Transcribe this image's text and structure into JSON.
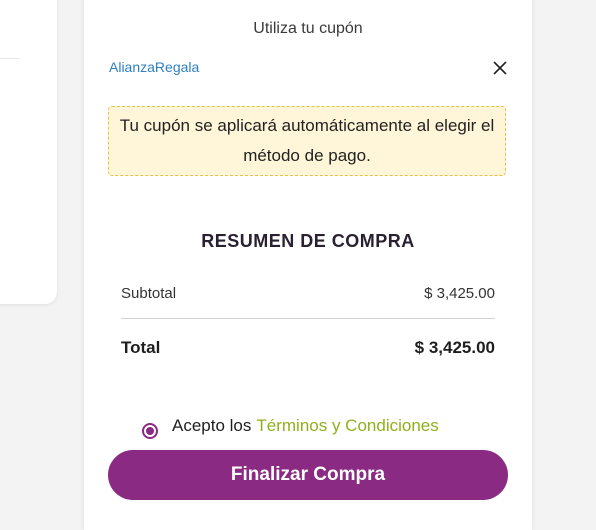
{
  "coupon": {
    "title": "Utiliza tu cupón",
    "code": "AlianzaRegala",
    "notice": "Tu cupón se aplicará automáticamente al elegir el método de pago."
  },
  "summary": {
    "title": "RESUMEN DE COMPRA",
    "subtotal_label": "Subtotal",
    "subtotal_value": "$ 3,425.00",
    "total_label": "Total",
    "total_value": "$ 3,425.00"
  },
  "terms": {
    "prefix": "Acepto los",
    "link": "Términos y Condiciones",
    "accepted": true
  },
  "actions": {
    "finish_label": "Finalizar Compra"
  },
  "colors": {
    "brand_purple": "#8b2a83",
    "link_green": "#8fb01e",
    "coupon_blue": "#2f7fc1",
    "notice_bg": "#fff6d9"
  },
  "icons": {
    "close": "close-icon"
  }
}
